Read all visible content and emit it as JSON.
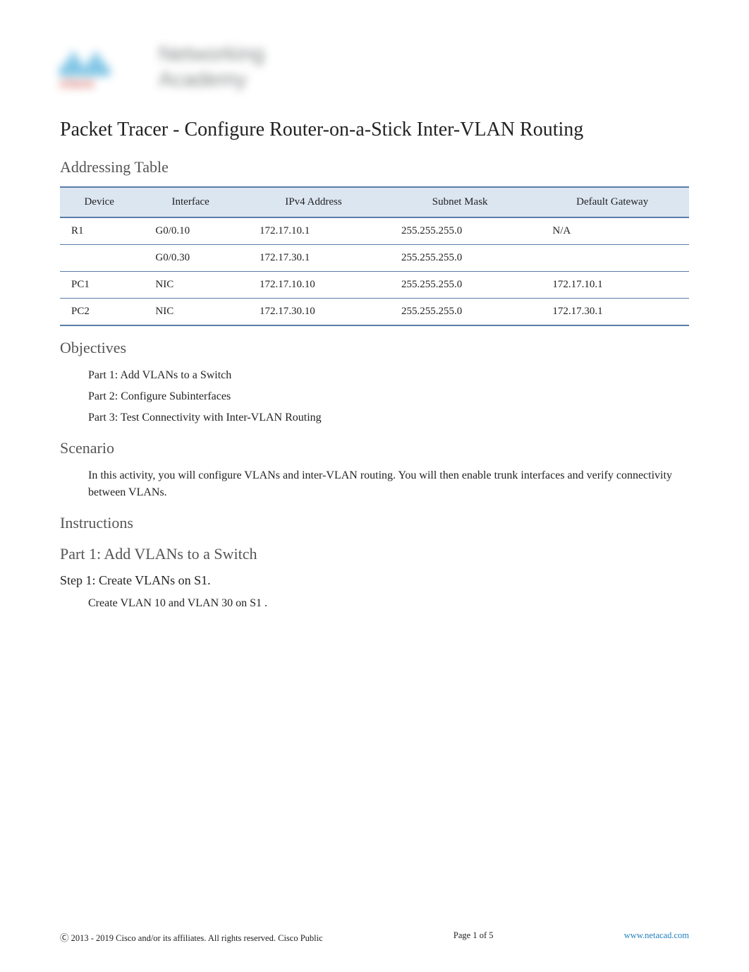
{
  "logo": {
    "brand": "cisco",
    "line1": "Networking",
    "line2": "Academy"
  },
  "title": "Packet Tracer - Configure Router-on-a-Stick Inter-VLAN Routing",
  "addressing": {
    "heading": "Addressing Table",
    "columns": [
      "Device",
      "Interface",
      "IPv4 Address",
      "Subnet Mask",
      "Default Gateway"
    ],
    "rows": [
      {
        "device": "R1",
        "interface": "G0/0.10",
        "ip": "172.17.10.1",
        "mask": "255.255.255.0",
        "gateway": "N/A"
      },
      {
        "device": "",
        "interface": "G0/0.30",
        "ip": "172.17.30.1",
        "mask": "255.255.255.0",
        "gateway": ""
      },
      {
        "device": "PC1",
        "interface": "NIC",
        "ip": "172.17.10.10",
        "mask": "255.255.255.0",
        "gateway": "172.17.10.1"
      },
      {
        "device": "PC2",
        "interface": "NIC",
        "ip": "172.17.30.10",
        "mask": "255.255.255.0",
        "gateway": "172.17.30.1"
      }
    ]
  },
  "objectives": {
    "heading": "Objectives",
    "items": [
      "Part 1: Add VLANs to a Switch",
      "Part 2: Configure Subinterfaces",
      "Part 3: Test Connectivity with Inter-VLAN Routing"
    ]
  },
  "scenario": {
    "heading": "Scenario",
    "text": "In this activity, you will configure VLANs and inter-VLAN routing. You will then enable trunk interfaces and verify connectivity between VLANs."
  },
  "instructions": {
    "heading": "Instructions",
    "part1": {
      "heading": "Part 1: Add VLANs to a Switch",
      "step1": {
        "heading": "Step 1: Create VLANs on S1.",
        "text": "Create VLAN 10 and VLAN 30 on    S1 ."
      }
    }
  },
  "footer": {
    "copyright": " 2013 - 2019 Cisco and/or its affiliates. All rights reserved. Cisco Public",
    "page": "Page   1  of 5",
    "url": "www.netacad.com"
  }
}
